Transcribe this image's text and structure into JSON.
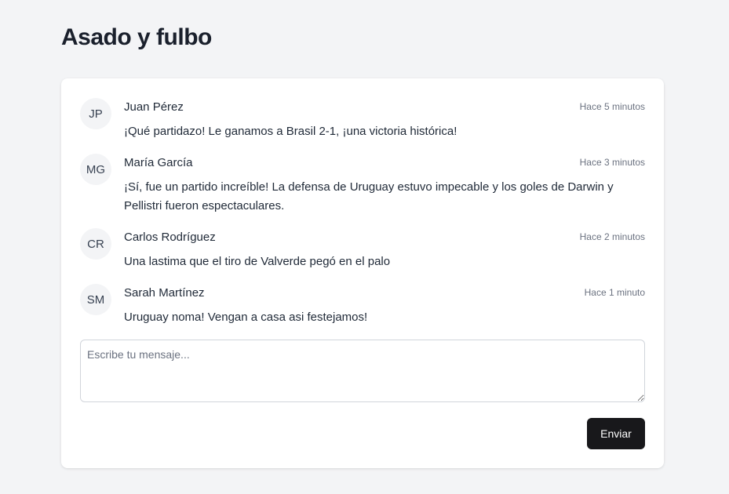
{
  "title": "Asado y fulbo",
  "messages": [
    {
      "initials": "JP",
      "name": "Juan Pérez",
      "time": "Hace 5 minutos",
      "text": "¡Qué partidazo! Le ganamos a Brasil 2-1, ¡una victoria histórica!"
    },
    {
      "initials": "MG",
      "name": "María García",
      "time": "Hace 3 minutos",
      "text": "¡Sí, fue un partido increíble! La defensa de Uruguay estuvo impecable y los goles de Darwin y Pellistri fueron espectaculares."
    },
    {
      "initials": "CR",
      "name": "Carlos Rodríguez",
      "time": "Hace 2 minutos",
      "text": "Una lastima que el tiro de Valverde pegó en el palo"
    },
    {
      "initials": "SM",
      "name": "Sarah Martínez",
      "time": "Hace 1 minuto",
      "text": "Uruguay noma! Vengan a casa asi festejamos!"
    }
  ],
  "composer": {
    "placeholder": "Escribe tu mensaje...",
    "value": "",
    "send_label": "Enviar"
  }
}
